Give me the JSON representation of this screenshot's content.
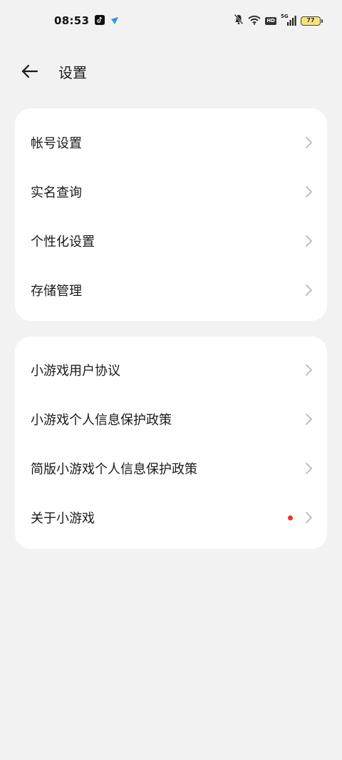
{
  "status_bar": {
    "time": "08:53",
    "tiktok_icon": "tiktok-app-icon",
    "feishu_icon": "feishu-app-icon",
    "mute_icon": "bell-muted-icon",
    "wifi_icon": "wifi-icon",
    "hd_label": "HD",
    "network_label": "5G",
    "battery_level": "77"
  },
  "header": {
    "back_icon": "arrow-left-icon",
    "title": "设置"
  },
  "colors": {
    "background": "#f2f2f2",
    "card": "#ffffff",
    "notification_dot": "#e1392b",
    "battery_fill": "#f7e27a"
  },
  "group1": {
    "items": [
      {
        "label": "帐号设置",
        "icon": "chevron-right-icon"
      },
      {
        "label": "实名查询",
        "icon": "chevron-right-icon"
      },
      {
        "label": "个性化设置",
        "icon": "chevron-right-icon"
      },
      {
        "label": "存储管理",
        "icon": "chevron-right-icon"
      }
    ]
  },
  "group2": {
    "items": [
      {
        "label": "小游戏用户协议",
        "icon": "chevron-right-icon"
      },
      {
        "label": "小游戏个人信息保护政策",
        "icon": "chevron-right-icon"
      },
      {
        "label": "简版小游戏个人信息保护政策",
        "icon": "chevron-right-icon"
      },
      {
        "label": "关于小游戏",
        "icon": "chevron-right-icon",
        "badge": "red-dot"
      }
    ]
  }
}
